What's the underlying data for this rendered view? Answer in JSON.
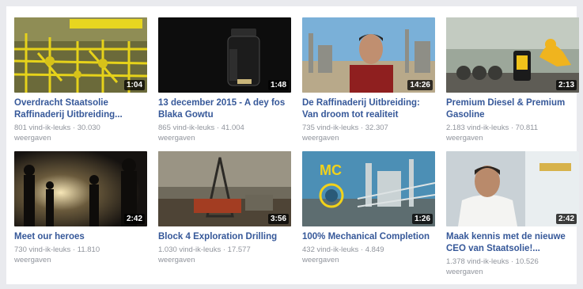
{
  "videos": [
    {
      "title": "Overdracht Staatsolie Raffinaderij Uitbreiding...",
      "likes": "801 vind-ik-leuks",
      "views": "30.030",
      "views_label": "weergaven",
      "duration": "1:04",
      "thumb_icon": "pipeline-yellow-thumbnail"
    },
    {
      "title": "13 december 2015 - A dey fos Blaka Gowtu",
      "likes": "865 vind-ik-leuks",
      "views": "41.004",
      "views_label": "weergaven",
      "duration": "1:48",
      "thumb_icon": "jar-dark-thumbnail"
    },
    {
      "title": "De Raffinaderij Uitbreiding: Van droom tot realiteit",
      "likes": "735 vind-ik-leuks",
      "views": "32.307",
      "views_label": "weergaven",
      "duration": "14:26",
      "thumb_icon": "man-refinery-thumbnail"
    },
    {
      "title": "Premium Diesel & Premium Gasoline",
      "likes": "2.183 vind-ik-leuks",
      "views": "70.811",
      "views_label": "weergaven",
      "duration": "2:13",
      "thumb_icon": "fuel-pump-thumbnail"
    },
    {
      "title": "Meet our heroes",
      "likes": "730 vind-ik-leuks",
      "views": "11.810",
      "views_label": "weergaven",
      "duration": "2:42",
      "thumb_icon": "workers-silhouette-thumbnail"
    },
    {
      "title": "Block 4 Exploration Drilling",
      "likes": "1.030 vind-ik-leuks",
      "views": "17.577",
      "views_label": "weergaven",
      "duration": "3:56",
      "thumb_icon": "drilling-rig-thumbnail"
    },
    {
      "title": "100% Mechanical Completion",
      "likes": "432 vind-ik-leuks",
      "views": "4.849",
      "views_label": "weergaven",
      "duration": "1:26",
      "thumb_icon": "mc-plant-thumbnail",
      "thumb_text": "MC"
    },
    {
      "title": "Maak kennis met de nieuwe CEO van Staatsolie!...",
      "likes": "1.378 vind-ik-leuks",
      "views": "10.526",
      "views_label": "weergaven",
      "duration": "2:42",
      "thumb_icon": "ceo-office-thumbnail"
    }
  ],
  "meta_separator": " · "
}
